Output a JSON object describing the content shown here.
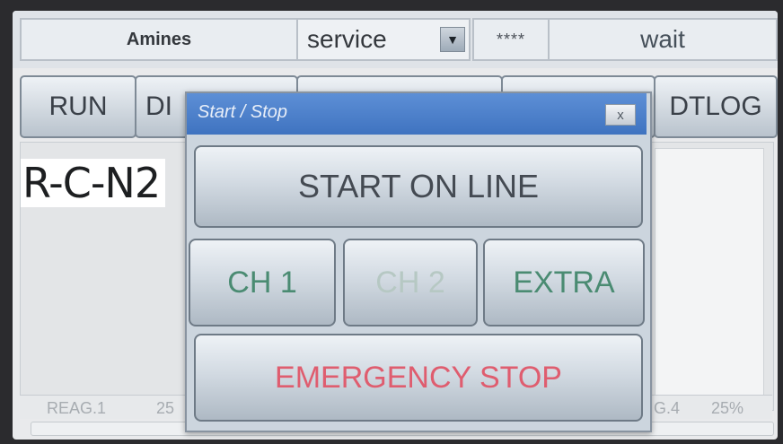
{
  "topbar": {
    "app_name": "Amines",
    "mode_value": "service",
    "dropdown_icon": "chevron-down-icon",
    "password_mask": "****",
    "status": "wait"
  },
  "tabs": {
    "run": "RUN",
    "di_partial": "DI",
    "dtlog": "DTLOG"
  },
  "main": {
    "unit_id_partial": "R-C-N2"
  },
  "reagents": {
    "reag1_label": "REAG.1",
    "reag1_value_partial": "25",
    "reag4_label_partial": "G.4",
    "reag4_value": "25%"
  },
  "dialog": {
    "title": "Start / Stop",
    "close_label": "x",
    "start_online_label": "START ON LINE",
    "ch1_label": "CH 1",
    "ch2_label": "CH 2",
    "extra_label": "EXTRA",
    "emergency_label": "EMERGENCY STOP"
  },
  "colors": {
    "title_bar": "#4a7fcb",
    "channel_text": "#4a8b72",
    "disabled_text": "#b6c8c3",
    "emergency_text": "#df5d6f"
  }
}
